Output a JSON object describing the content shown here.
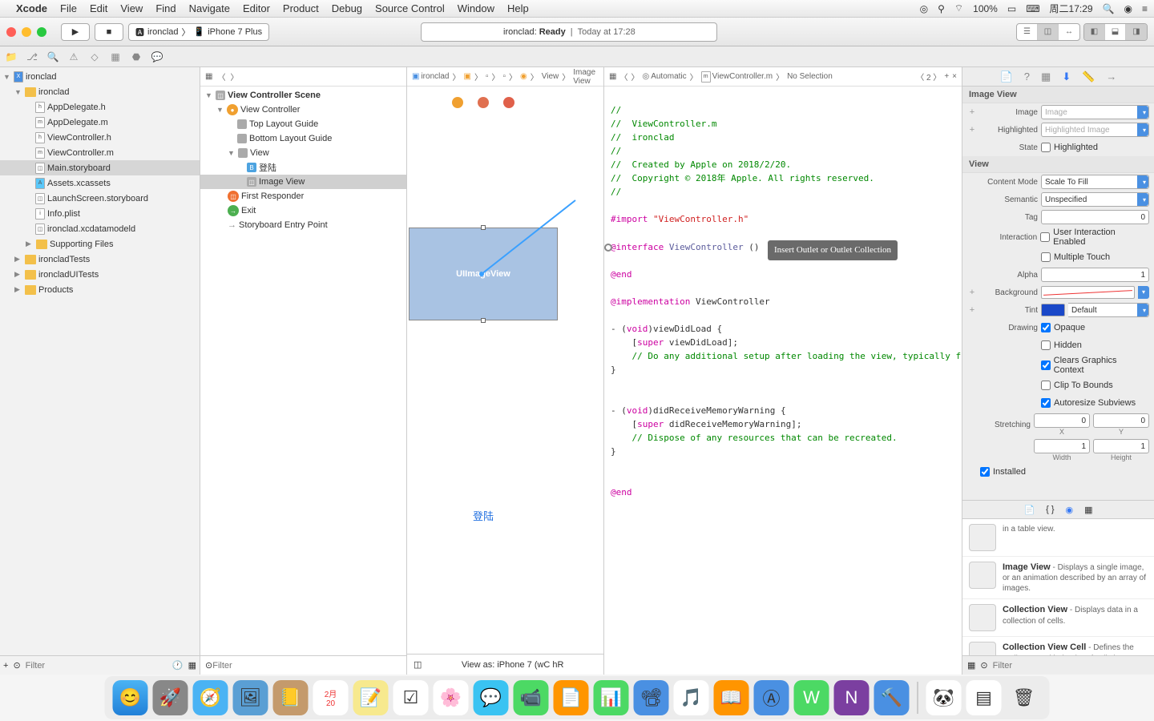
{
  "menubar": {
    "app": "Xcode",
    "items": [
      "File",
      "Edit",
      "View",
      "Find",
      "Navigate",
      "Editor",
      "Product",
      "Debug",
      "Source Control",
      "Window",
      "Help"
    ],
    "battery": "100%",
    "clock": "周二17:29"
  },
  "toolbar": {
    "scheme_app": "ironclad",
    "scheme_device": "iPhone 7 Plus",
    "status_project": "ironclad:",
    "status_state": "Ready",
    "status_time": "Today at 17:28"
  },
  "navigator": {
    "project": "ironclad",
    "group": "ironclad",
    "files": [
      "AppDelegate.h",
      "AppDelegate.m",
      "ViewController.h",
      "ViewController.m",
      "Main.storyboard",
      "Assets.xcassets",
      "LaunchScreen.storyboard",
      "Info.plist",
      "ironclad.xcdatamodeld"
    ],
    "supporting": "Supporting Files",
    "targets": [
      "ironcladTests",
      "ironcladUITests",
      "Products"
    ],
    "filter_ph": "Filter"
  },
  "outline": {
    "scene": "View Controller Scene",
    "vc": "View Controller",
    "tlg": "Top Layout Guide",
    "blg": "Bottom Layout Guide",
    "view": "View",
    "btn": "登陆",
    "img": "Image View",
    "fr": "First Responder",
    "exit": "Exit",
    "entry": "Storyboard Entry Point",
    "filter_ph": "Filter"
  },
  "canvas": {
    "crumbs": [
      "ironclad",
      "",
      "",
      "",
      "",
      "View",
      "Image View"
    ],
    "imgview_label": "UIImageView",
    "btn_label": "登陆",
    "bottom": "View as: iPhone 7 (wC hR"
  },
  "editor": {
    "crumbs_mode": "Automatic",
    "crumbs_file": "ViewController.m",
    "crumbs_sel": "No Selection",
    "counter": "2",
    "tooltip": "Insert Outlet or Outlet Collection",
    "code": {
      "l1": "//",
      "l2": "//  ViewController.m",
      "l3": "//  ironclad",
      "l4": "//",
      "l5": "//  Created by Apple on 2018/2/20.",
      "l6": "//  Copyright © 2018年 Apple. All rights reserved.",
      "l7": "//",
      "l8": "",
      "l9a": "#import ",
      "l9b": "\"ViewController.h\"",
      "l11a": "@interface ",
      "l11b": "ViewController",
      "l11c": " ()",
      "l13": "@end",
      "l15a": "@implementation",
      "l15b": " ViewController",
      "l17a": "- (",
      "l17b": "void",
      "l17c": ")viewDidLoad {",
      "l18a": "    [",
      "l18b": "super",
      "l18c": " viewDidLoad];",
      "l19": "    // Do any additional setup after loading the view, typically from a nib.",
      "l20": "}",
      "l23a": "- (",
      "l23b": "void",
      "l23c": ")didReceiveMemoryWarning {",
      "l24a": "    [",
      "l24b": "super",
      "l24c": " didReceiveMemoryWarning];",
      "l25": "    // Dispose of any resources that can be recreated.",
      "l26": "}",
      "l29": "@end"
    }
  },
  "inspector": {
    "section1": "Image View",
    "image_lbl": "Image",
    "image_ph": "Image",
    "high_lbl": "Highlighted",
    "high_ph": "Highlighted Image",
    "state_lbl": "State",
    "state_chk": "Highlighted",
    "section2": "View",
    "cm_lbl": "Content Mode",
    "cm_val": "Scale To Fill",
    "sem_lbl": "Semantic",
    "sem_val": "Unspecified",
    "tag_lbl": "Tag",
    "tag_val": "0",
    "int_lbl": "Interaction",
    "int_chk1": "User Interaction Enabled",
    "int_chk2": "Multiple Touch",
    "alpha_lbl": "Alpha",
    "alpha_val": "1",
    "bg_lbl": "Background",
    "tint_lbl": "Tint",
    "tint_val": "Default",
    "draw_lbl": "Drawing",
    "draw_opts": [
      "Opaque",
      "Hidden",
      "Clears Graphics Context",
      "Clip To Bounds",
      "Autoresize Subviews"
    ],
    "stretch_lbl": "Stretching",
    "stretch_x": "0",
    "stretch_y": "0",
    "stretch_w": "1",
    "stretch_h": "1",
    "stretch_xl": "X",
    "stretch_yl": "Y",
    "stretch_wl": "Width",
    "stretch_hl": "Height",
    "installed": "Installed",
    "lib": [
      {
        "t": "",
        "d": "in a table view."
      },
      {
        "t": "Image View",
        "d": "- Displays a single image, or an animation described by an array of images."
      },
      {
        "t": "Collection View",
        "d": "- Displays data in a collection of cells."
      },
      {
        "t": "Collection View Cell",
        "d": "- Defines the attributes and behavior of cells in a"
      }
    ],
    "filter_ph": "Filter"
  }
}
